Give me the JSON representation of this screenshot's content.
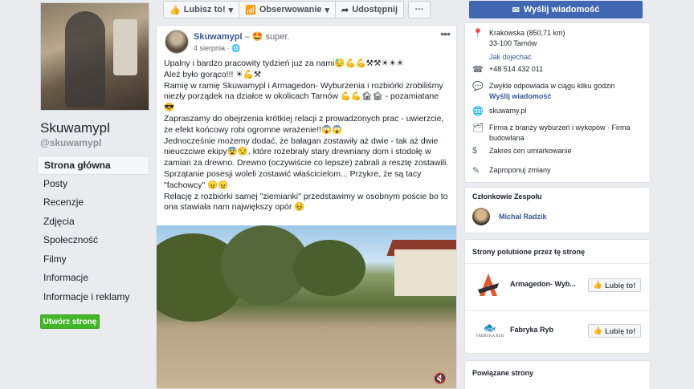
{
  "page": {
    "name": "Skuwamypl",
    "handle": "@skuwamypl",
    "create_page_label": "Utwórz stronę"
  },
  "left_nav": [
    {
      "label": "Strona główna",
      "active": true
    },
    {
      "label": "Posty"
    },
    {
      "label": "Recenzje"
    },
    {
      "label": "Zdjęcia"
    },
    {
      "label": "Społeczność"
    },
    {
      "label": "Filmy"
    },
    {
      "label": "Informacje"
    },
    {
      "label": "Informacje i reklamy"
    }
  ],
  "actions": {
    "like": "Lubisz to!",
    "follow": "Obserwowanie",
    "share": "Udostępnij",
    "more": "···",
    "send_message": "Wyślij wiadomość"
  },
  "post": {
    "author": "Skuwamypl",
    "feeling": "– 🤩 super.",
    "date": "4 sierpnia · 🌐",
    "paragraphs": [
      "Upalny i bardzo pracowity tydzień już za nami😓💪💪⚒⚒☀☀☀",
      "Ależ było gorąco!!! ☀💪⚒",
      "Ramię w ramię Skuwamypl i Armagedon- Wyburzenia i rozbiórki zrobiliśmy niezły porządek na działce w okolicach Tarnów 💪💪🏚🏚 - pozamiatane 😎",
      "Zapraszamy do obejrzenia krótkiej relacji z prowadzonych prac - uwierzcie, że efekt końcowy robi ogromne wrażenie!!😱😱",
      "Jednocześnie możemy dodać, że bałagan zostawiły aż dwie - tak aż dwie nieuczciwe ekipy😨😒, które rozebrały stary drewniany dom i stodołę w zamian za drewno. Drewno (oczywiście co lepsze) zabrali a resztę zostawili. Sprzątanie posesji woleli zostawić właścicielom... Przykre, że są tacy \"fachowcy\" 😠😠",
      "Relację z rozbiórki samej \"ziemianki\" przedstawimy w osobnym poście bo to ona stawiała nam największy opór 😣"
    ]
  },
  "about": {
    "address_line1": "Krakowska (850,71 km)",
    "address_line2": "33-100 Tarnów",
    "directions": "Jak dojechać",
    "phone": "+48 514 432 011",
    "response": "Zwykle odpowiada w ciągu kilku godzin",
    "send_message": "Wyślij wiadomość",
    "website": "skuwamy.pl",
    "category": "Firma z branży wyburzeń i wykopów · Firma budowlana",
    "price": "Zakres cen umiarkowanie",
    "suggest": "Zaproponuj zmiany"
  },
  "team": {
    "title": "Członkowie Zespołu",
    "member": "Michał Radzik"
  },
  "liked_pages": {
    "title": "Strony polubione przez tę stronę",
    "items": [
      {
        "name": "Armagedon- Wyb...",
        "button": "Lubię to!"
      },
      {
        "name": "Fabryka Ryb",
        "button": "Lubię to!",
        "logo_text": "FABRYKA RYB"
      }
    ]
  },
  "related": {
    "title": "Powiązane strony"
  },
  "colors": {
    "fb_blue": "#4267b2",
    "link": "#385898",
    "green": "#42b72a"
  }
}
